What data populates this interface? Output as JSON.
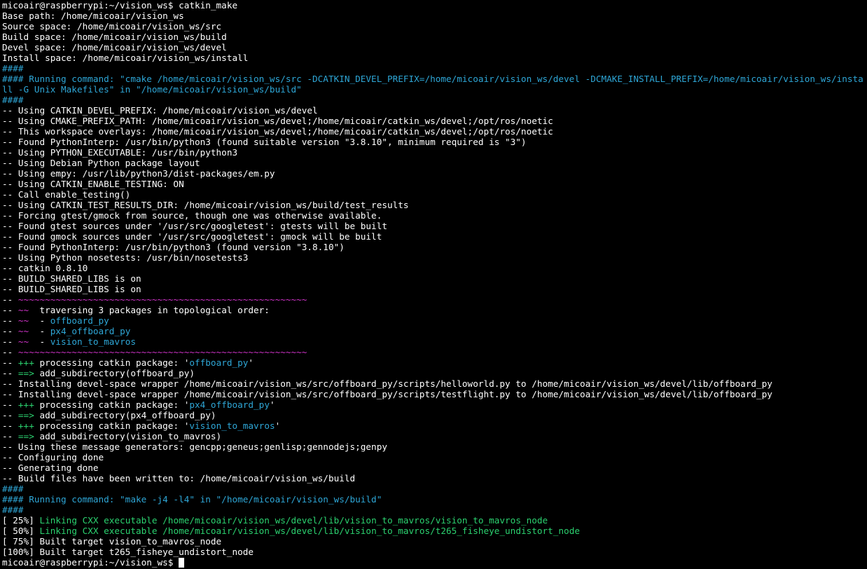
{
  "colors": {
    "background": "#000000",
    "default": "#ffffff",
    "cyan": "#2ea6d6",
    "green": "#2bd16f",
    "magenta": "#d033c9"
  },
  "lines": [
    [
      {
        "t": "micoair@raspberrypi:~/vision_ws$ catkin_make",
        "c": "default"
      }
    ],
    [
      {
        "t": "Base path: /home/micoair/vision_ws",
        "c": "default"
      }
    ],
    [
      {
        "t": "Source space: /home/micoair/vision_ws/src",
        "c": "default"
      }
    ],
    [
      {
        "t": "Build space: /home/micoair/vision_ws/build",
        "c": "default"
      }
    ],
    [
      {
        "t": "Devel space: /home/micoair/vision_ws/devel",
        "c": "default"
      }
    ],
    [
      {
        "t": "Install space: /home/micoair/vision_ws/install",
        "c": "default"
      }
    ],
    [
      {
        "t": "####",
        "c": "cyan"
      }
    ],
    [
      {
        "t": "#### Running command: \"cmake /home/micoair/vision_ws/src -DCATKIN_DEVEL_PREFIX=/home/micoair/vision_ws/devel -DCMAKE_INSTALL_PREFIX=/home/micoair/vision_ws/install -G Unix Makefiles\" in \"/home/micoair/vision_ws/build\"",
        "c": "cyan",
        "wrap": true
      }
    ],
    [
      {
        "t": "####",
        "c": "cyan"
      }
    ],
    [
      {
        "t": "-- Using CATKIN_DEVEL_PREFIX: /home/micoair/vision_ws/devel",
        "c": "default"
      }
    ],
    [
      {
        "t": "-- Using CMAKE_PREFIX_PATH: /home/micoair/vision_ws/devel;/home/micoair/catkin_ws/devel;/opt/ros/noetic",
        "c": "default"
      }
    ],
    [
      {
        "t": "-- This workspace overlays: /home/micoair/vision_ws/devel;/home/micoair/catkin_ws/devel;/opt/ros/noetic",
        "c": "default"
      }
    ],
    [
      {
        "t": "-- Found PythonInterp: /usr/bin/python3 (found suitable version \"3.8.10\", minimum required is \"3\")",
        "c": "default"
      }
    ],
    [
      {
        "t": "-- Using PYTHON_EXECUTABLE: /usr/bin/python3",
        "c": "default"
      }
    ],
    [
      {
        "t": "-- Using Debian Python package layout",
        "c": "default"
      }
    ],
    [
      {
        "t": "-- Using empy: /usr/lib/python3/dist-packages/em.py",
        "c": "default"
      }
    ],
    [
      {
        "t": "-- Using CATKIN_ENABLE_TESTING: ON",
        "c": "default"
      }
    ],
    [
      {
        "t": "-- Call enable_testing()",
        "c": "default"
      }
    ],
    [
      {
        "t": "-- Using CATKIN_TEST_RESULTS_DIR: /home/micoair/vision_ws/build/test_results",
        "c": "default"
      }
    ],
    [
      {
        "t": "-- Forcing gtest/gmock from source, though one was otherwise available.",
        "c": "default"
      }
    ],
    [
      {
        "t": "-- Found gtest sources under '/usr/src/googletest': gtests will be built",
        "c": "default"
      }
    ],
    [
      {
        "t": "-- Found gmock sources under '/usr/src/googletest': gmock will be built",
        "c": "default"
      }
    ],
    [
      {
        "t": "-- Found PythonInterp: /usr/bin/python3 (found version \"3.8.10\")",
        "c": "default"
      }
    ],
    [
      {
        "t": "-- Using Python nosetests: /usr/bin/nosetests3",
        "c": "default"
      }
    ],
    [
      {
        "t": "-- catkin 0.8.10",
        "c": "default"
      }
    ],
    [
      {
        "t": "-- BUILD_SHARED_LIBS is on",
        "c": "default"
      }
    ],
    [
      {
        "t": "-- BUILD_SHARED_LIBS is on",
        "c": "default"
      }
    ],
    [
      {
        "t": "-- ",
        "c": "default"
      },
      {
        "t": "~~~~~~~~~~~~~~~~~~~~~~~~~~~~~~~~~~~~~~~~~~~~~~~~~~~~~~",
        "c": "magenta"
      }
    ],
    [
      {
        "t": "-- ",
        "c": "default"
      },
      {
        "t": "~~",
        "c": "magenta"
      },
      {
        "t": "  traversing 3 packages in topological order:",
        "c": "default"
      }
    ],
    [
      {
        "t": "-- ",
        "c": "default"
      },
      {
        "t": "~~",
        "c": "magenta"
      },
      {
        "t": "  - ",
        "c": "default"
      },
      {
        "t": "offboard_py",
        "c": "cyan"
      }
    ],
    [
      {
        "t": "-- ",
        "c": "default"
      },
      {
        "t": "~~",
        "c": "magenta"
      },
      {
        "t": "  - ",
        "c": "default"
      },
      {
        "t": "px4_offboard_py",
        "c": "cyan"
      }
    ],
    [
      {
        "t": "-- ",
        "c": "default"
      },
      {
        "t": "~~",
        "c": "magenta"
      },
      {
        "t": "  - ",
        "c": "default"
      },
      {
        "t": "vision_to_mavros",
        "c": "cyan"
      }
    ],
    [
      {
        "t": "-- ",
        "c": "default"
      },
      {
        "t": "~~~~~~~~~~~~~~~~~~~~~~~~~~~~~~~~~~~~~~~~~~~~~~~~~~~~~~",
        "c": "magenta"
      }
    ],
    [
      {
        "t": "-- ",
        "c": "default"
      },
      {
        "t": "+++",
        "c": "green"
      },
      {
        "t": " processing catkin package: '",
        "c": "default"
      },
      {
        "t": "offboard_py",
        "c": "cyan"
      },
      {
        "t": "'",
        "c": "default"
      }
    ],
    [
      {
        "t": "-- ",
        "c": "default"
      },
      {
        "t": "==>",
        "c": "green"
      },
      {
        "t": " add_subdirectory(offboard_py)",
        "c": "default"
      }
    ],
    [
      {
        "t": "-- Installing devel-space wrapper /home/micoair/vision_ws/src/offboard_py/scripts/helloworld.py to /home/micoair/vision_ws/devel/lib/offboard_py",
        "c": "default"
      }
    ],
    [
      {
        "t": "-- Installing devel-space wrapper /home/micoair/vision_ws/src/offboard_py/scripts/testflight.py to /home/micoair/vision_ws/devel/lib/offboard_py",
        "c": "default"
      }
    ],
    [
      {
        "t": "-- ",
        "c": "default"
      },
      {
        "t": "+++",
        "c": "green"
      },
      {
        "t": " processing catkin package: '",
        "c": "default"
      },
      {
        "t": "px4_offboard_py",
        "c": "cyan"
      },
      {
        "t": "'",
        "c": "default"
      }
    ],
    [
      {
        "t": "-- ",
        "c": "default"
      },
      {
        "t": "==>",
        "c": "green"
      },
      {
        "t": " add_subdirectory(px4_offboard_py)",
        "c": "default"
      }
    ],
    [
      {
        "t": "-- ",
        "c": "default"
      },
      {
        "t": "+++",
        "c": "green"
      },
      {
        "t": " processing catkin package: '",
        "c": "default"
      },
      {
        "t": "vision_to_mavros",
        "c": "cyan"
      },
      {
        "t": "'",
        "c": "default"
      }
    ],
    [
      {
        "t": "-- ",
        "c": "default"
      },
      {
        "t": "==>",
        "c": "green"
      },
      {
        "t": " add_subdirectory(vision_to_mavros)",
        "c": "default"
      }
    ],
    [
      {
        "t": "-- Using these message generators: gencpp;geneus;genlisp;gennodejs;genpy",
        "c": "default"
      }
    ],
    [
      {
        "t": "-- Configuring done",
        "c": "default"
      }
    ],
    [
      {
        "t": "-- Generating done",
        "c": "default"
      }
    ],
    [
      {
        "t": "-- Build files have been written to: /home/micoair/vision_ws/build",
        "c": "default"
      }
    ],
    [
      {
        "t": "####",
        "c": "cyan"
      }
    ],
    [
      {
        "t": "#### Running command: \"make -j4 -l4\" in \"/home/micoair/vision_ws/build\"",
        "c": "cyan"
      }
    ],
    [
      {
        "t": "####",
        "c": "cyan"
      }
    ],
    [
      {
        "t": "[ 25%] ",
        "c": "default"
      },
      {
        "t": "Linking CXX executable /home/micoair/vision_ws/devel/lib/vision_to_mavros/vision_to_mavros_node",
        "c": "green"
      }
    ],
    [
      {
        "t": "[ 50%] ",
        "c": "default"
      },
      {
        "t": "Linking CXX executable /home/micoair/vision_ws/devel/lib/vision_to_mavros/t265_fisheye_undistort_node",
        "c": "green"
      }
    ],
    [
      {
        "t": "[ 75%] Built target vision_to_mavros_node",
        "c": "default"
      }
    ],
    [
      {
        "t": "[100%] Built target t265_fisheye_undistort_node",
        "c": "default"
      }
    ],
    [
      {
        "t": "micoair@raspberrypi:~/vision_ws$ ",
        "c": "default",
        "cursor": true
      }
    ]
  ]
}
